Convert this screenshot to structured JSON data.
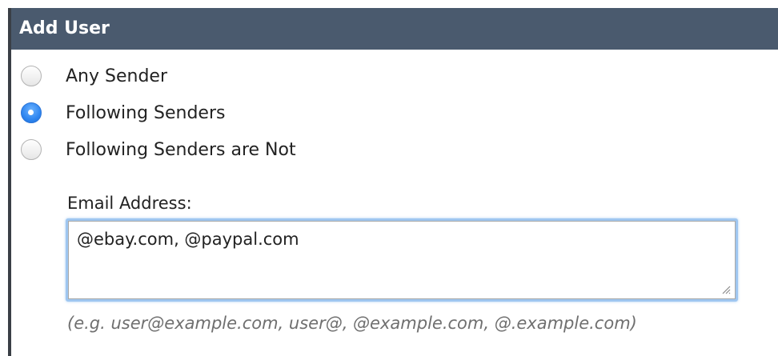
{
  "header": {
    "title": "Add User"
  },
  "sender_options": [
    {
      "label": "Any Sender",
      "checked": false
    },
    {
      "label": "Following Senders",
      "checked": true
    },
    {
      "label": "Following Senders are Not",
      "checked": false
    }
  ],
  "email_field": {
    "label": "Email Address:",
    "value": "@ebay.com, @paypal.com",
    "hint": "(e.g. user@example.com, user@, @example.com, @.example.com)"
  },
  "colors": {
    "header_bg": "#4a5a6e",
    "radio_selected": "#2f86f0",
    "focus_ring": "#9fc6f0"
  },
  "icons": {
    "resize_grip": "resize-grip-icon"
  }
}
